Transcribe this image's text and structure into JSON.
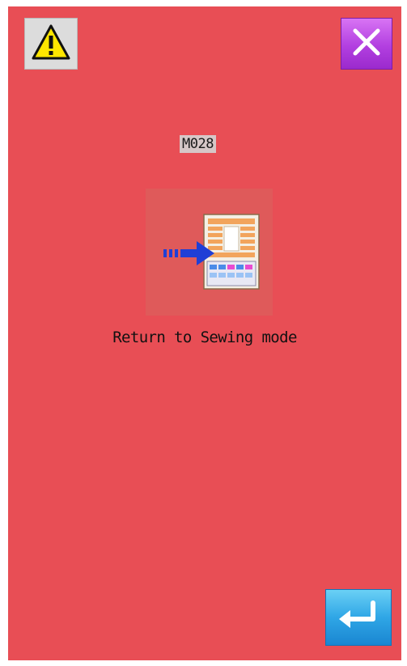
{
  "header": {
    "warning_icon": "warning-triangle-icon",
    "close_icon": "close-x-icon"
  },
  "message": {
    "code": "M028",
    "text": "Return to Sewing mode",
    "icon": "return-to-sewing-mode-icon"
  },
  "footer": {
    "enter_icon": "enter-return-icon"
  },
  "colors": {
    "background": "#e84e55",
    "close_button": "#b23fe0",
    "enter_button": "#2fa6e6",
    "warning_button": "#dcdcdc"
  }
}
